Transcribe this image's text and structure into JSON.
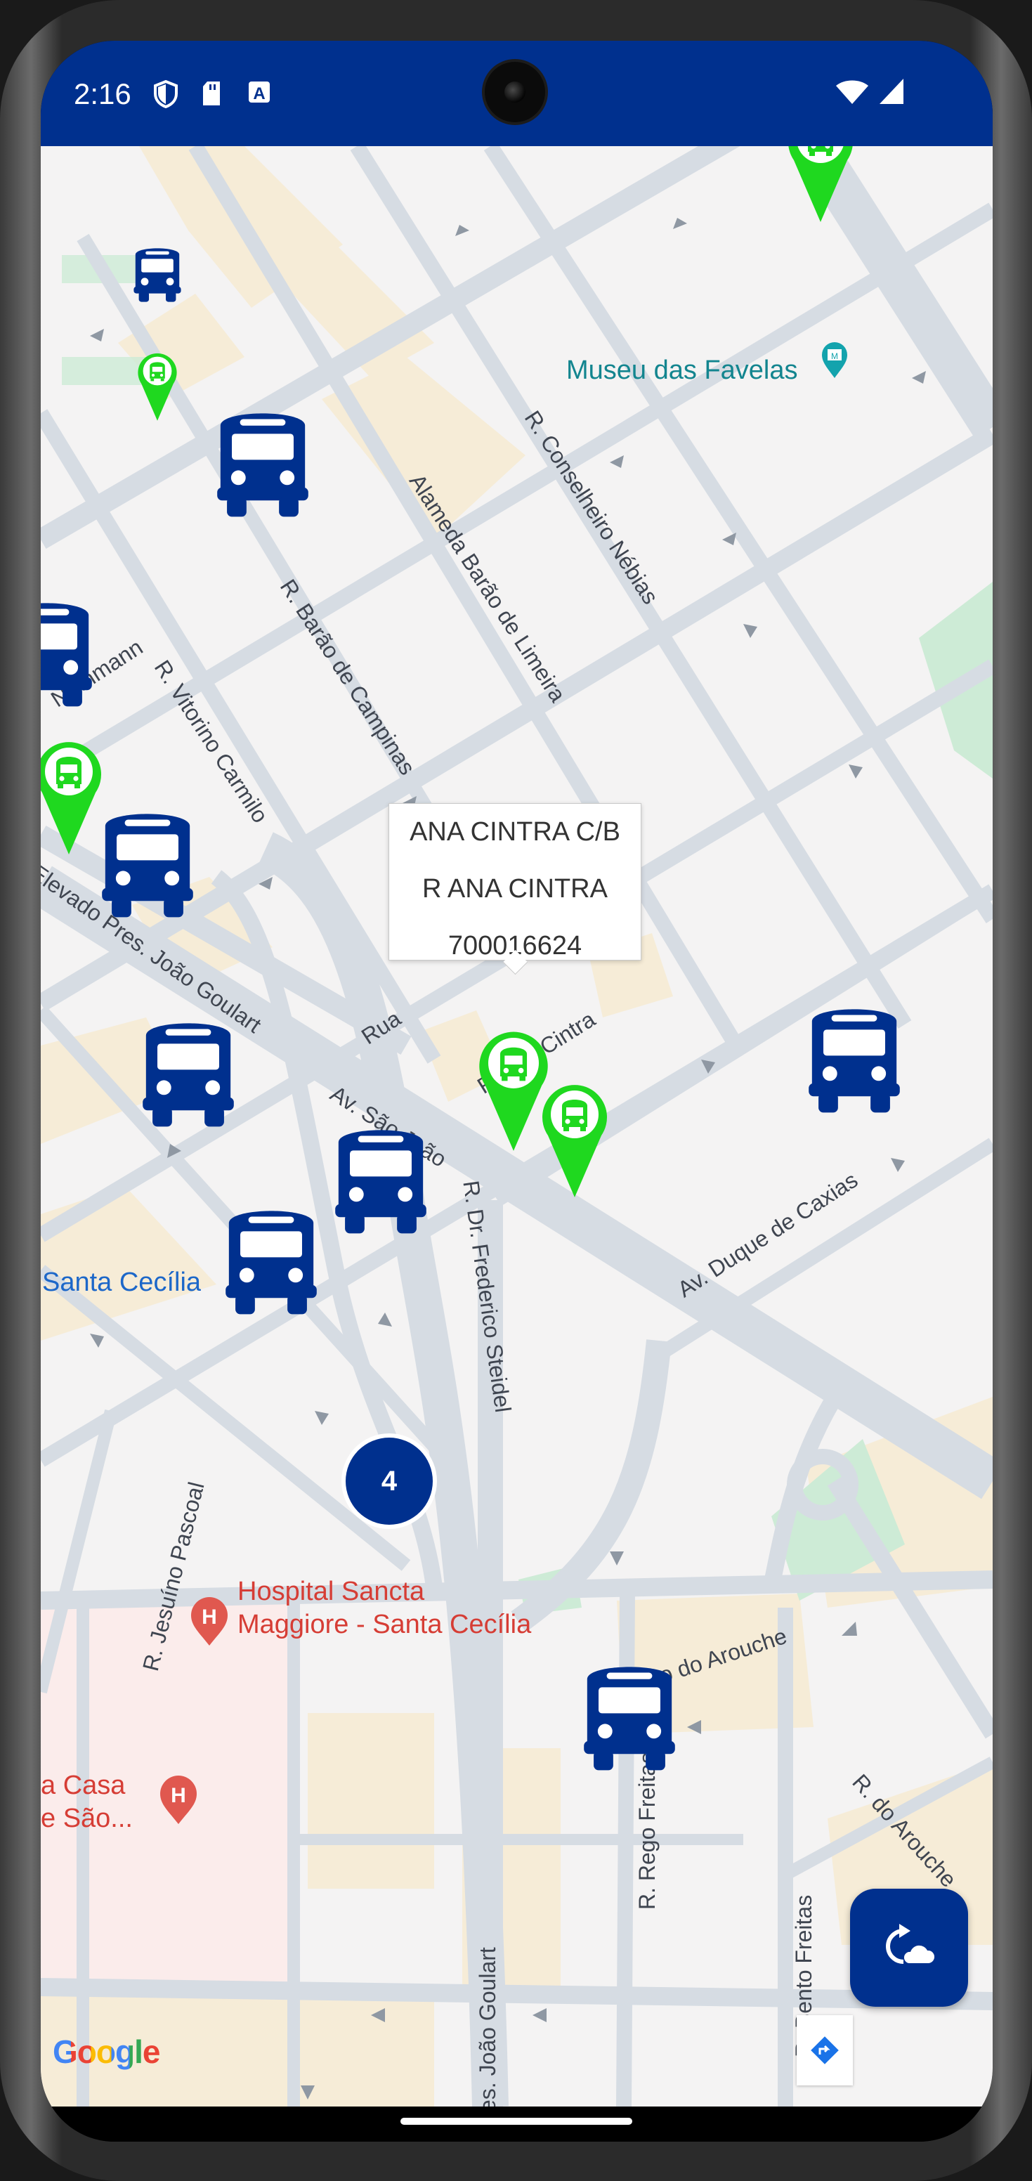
{
  "status_bar": {
    "time": "2:16",
    "icons": [
      "shield-icon",
      "sd-card-icon",
      "text-a-icon",
      "wifi-icon",
      "signal-icon"
    ],
    "background": "#00308e"
  },
  "map": {
    "streets": [
      "R. Conselheiro Nébias",
      "Alameda Barão de Limeira",
      "R. Barão de Campinas",
      "R. Vitorino Carmilo",
      "Nothmann",
      "Elevado Pres. João Goulart",
      "Av. São João",
      "Rua",
      "R. Ana Cintra",
      "Av. Duque de Caxias",
      "R. Dr. Frederico Steidel",
      "R. Jesuíno Pascoal",
      "Largo do Arouche",
      "R. do Arouche",
      "R. Rego Freitas",
      "R. Bento Freitas",
      "Pres. João Goulart"
    ],
    "pois": {
      "museum": "Museu das Favelas",
      "hospital": [
        "Hospital Sancta",
        "Maggiore - Santa Cecília"
      ],
      "casa": [
        "a Casa",
        "e São..."
      ],
      "metro": "Santa Cecília"
    },
    "cluster_count": "4",
    "info_window": {
      "line1": "ANA CINTRA C/B",
      "line2": "R ANA CINTRA",
      "line3": "700016624"
    },
    "attribution": "Google",
    "colors": {
      "bus_blue": "#00308e",
      "stop_green": "#1fd81f",
      "road": "#d6dce3",
      "block": "#f4f3f3",
      "building": "#f6ecd7",
      "park": "#cdebd6"
    }
  },
  "fab": {
    "icon": "refresh-cloud-icon"
  },
  "directions_button": {
    "icon": "directions-icon"
  }
}
